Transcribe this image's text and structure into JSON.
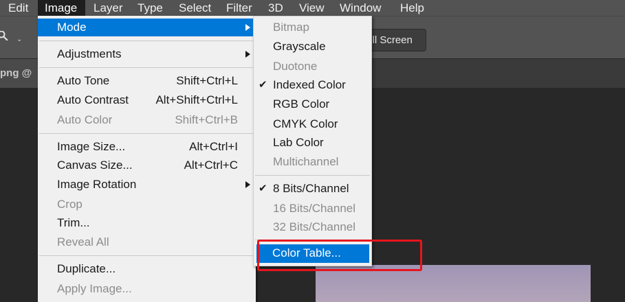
{
  "menubar": {
    "items": [
      "Edit",
      "Image",
      "Layer",
      "Type",
      "Select",
      "Filter",
      "3D",
      "View",
      "Window",
      "Help"
    ],
    "active": "Image"
  },
  "options_bar": {
    "fill_screen_button": "Fill Screen"
  },
  "document_tab": {
    "title": "png @"
  },
  "image_menu": {
    "items": [
      {
        "label": "Mode",
        "shortcut": "",
        "submenu": true,
        "disabled": false,
        "highlighted": true
      },
      {
        "label": "Adjustments",
        "shortcut": "",
        "submenu": true,
        "disabled": false
      },
      {
        "label": "Auto Tone",
        "shortcut": "Shift+Ctrl+L",
        "disabled": false
      },
      {
        "label": "Auto Contrast",
        "shortcut": "Alt+Shift+Ctrl+L",
        "disabled": false
      },
      {
        "label": "Auto Color",
        "shortcut": "Shift+Ctrl+B",
        "disabled": true
      },
      {
        "label": "Image Size...",
        "shortcut": "Alt+Ctrl+I",
        "disabled": false
      },
      {
        "label": "Canvas Size...",
        "shortcut": "Alt+Ctrl+C",
        "disabled": false
      },
      {
        "label": "Image Rotation",
        "shortcut": "",
        "submenu": true,
        "disabled": false
      },
      {
        "label": "Crop",
        "shortcut": "",
        "disabled": true
      },
      {
        "label": "Trim...",
        "shortcut": "",
        "disabled": false
      },
      {
        "label": "Reveal All",
        "shortcut": "",
        "disabled": true
      },
      {
        "label": "Duplicate...",
        "shortcut": "",
        "disabled": false
      },
      {
        "label": "Apply Image...",
        "shortcut": "",
        "disabled": true
      }
    ]
  },
  "mode_submenu": {
    "items": [
      {
        "label": "Bitmap",
        "disabled": true,
        "checked": false
      },
      {
        "label": "Grayscale",
        "disabled": false,
        "checked": false
      },
      {
        "label": "Duotone",
        "disabled": true,
        "checked": false
      },
      {
        "label": "Indexed Color",
        "disabled": false,
        "checked": true
      },
      {
        "label": "RGB Color",
        "disabled": false,
        "checked": false
      },
      {
        "label": "CMYK Color",
        "disabled": false,
        "checked": false
      },
      {
        "label": "Lab Color",
        "disabled": false,
        "checked": false
      },
      {
        "label": "Multichannel",
        "disabled": true,
        "checked": false
      },
      {
        "label": "8 Bits/Channel",
        "disabled": false,
        "checked": true
      },
      {
        "label": "16 Bits/Channel",
        "disabled": true,
        "checked": false
      },
      {
        "label": "32 Bits/Channel",
        "disabled": true,
        "checked": false
      },
      {
        "label": "Color Table...",
        "disabled": false,
        "checked": false,
        "highlighted": true
      }
    ]
  },
  "icons": {
    "checkmark": "checkmark-icon",
    "submenu_arrow": "submenu-arrow-icon",
    "zoom_tool": "zoom-icon"
  },
  "colors": {
    "highlight": "#0078d7",
    "callout": "#e8141c",
    "menubar": "#535353",
    "menu_bg": "#f0f0f0"
  }
}
